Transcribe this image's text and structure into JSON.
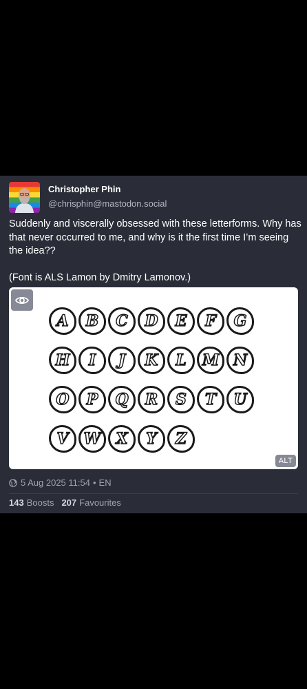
{
  "author": {
    "display_name": "Christopher Phin",
    "handle": "@chrisphin@mastodon.social"
  },
  "post": {
    "paragraphs": [
      "Suddenly and viscerally obsessed with these letterforms. Why has that never occurred to me, and why is it the first time I’m seeing the idea??",
      "(Font is ALS Lamon by Dmitry Lamonov.)"
    ],
    "media": {
      "alt_badge": "ALT",
      "letter_rows": [
        [
          "A",
          "B",
          "C",
          "D",
          "E",
          "F",
          "G"
        ],
        [
          "H",
          "I",
          "J",
          "K",
          "L",
          "M",
          "N"
        ],
        [
          "O",
          "P",
          "Q",
          "R",
          "S",
          "T",
          "U"
        ],
        [
          "V",
          "W",
          "X",
          "Y",
          "Z"
        ]
      ]
    },
    "visibility_icon": "globe-icon",
    "timestamp": "5 Aug 2025 11:54",
    "separator": "•",
    "language": "EN"
  },
  "stats": {
    "boosts_count": "143",
    "boosts_label": "Boosts",
    "favourites_count": "207",
    "favourites_label": "Favourites"
  },
  "colors": {
    "page_background": "#000000",
    "card_background": "#2a2d37",
    "primary_text": "#ffffff",
    "secondary_text": "#9fa3b1",
    "badge_background": "#868995"
  }
}
